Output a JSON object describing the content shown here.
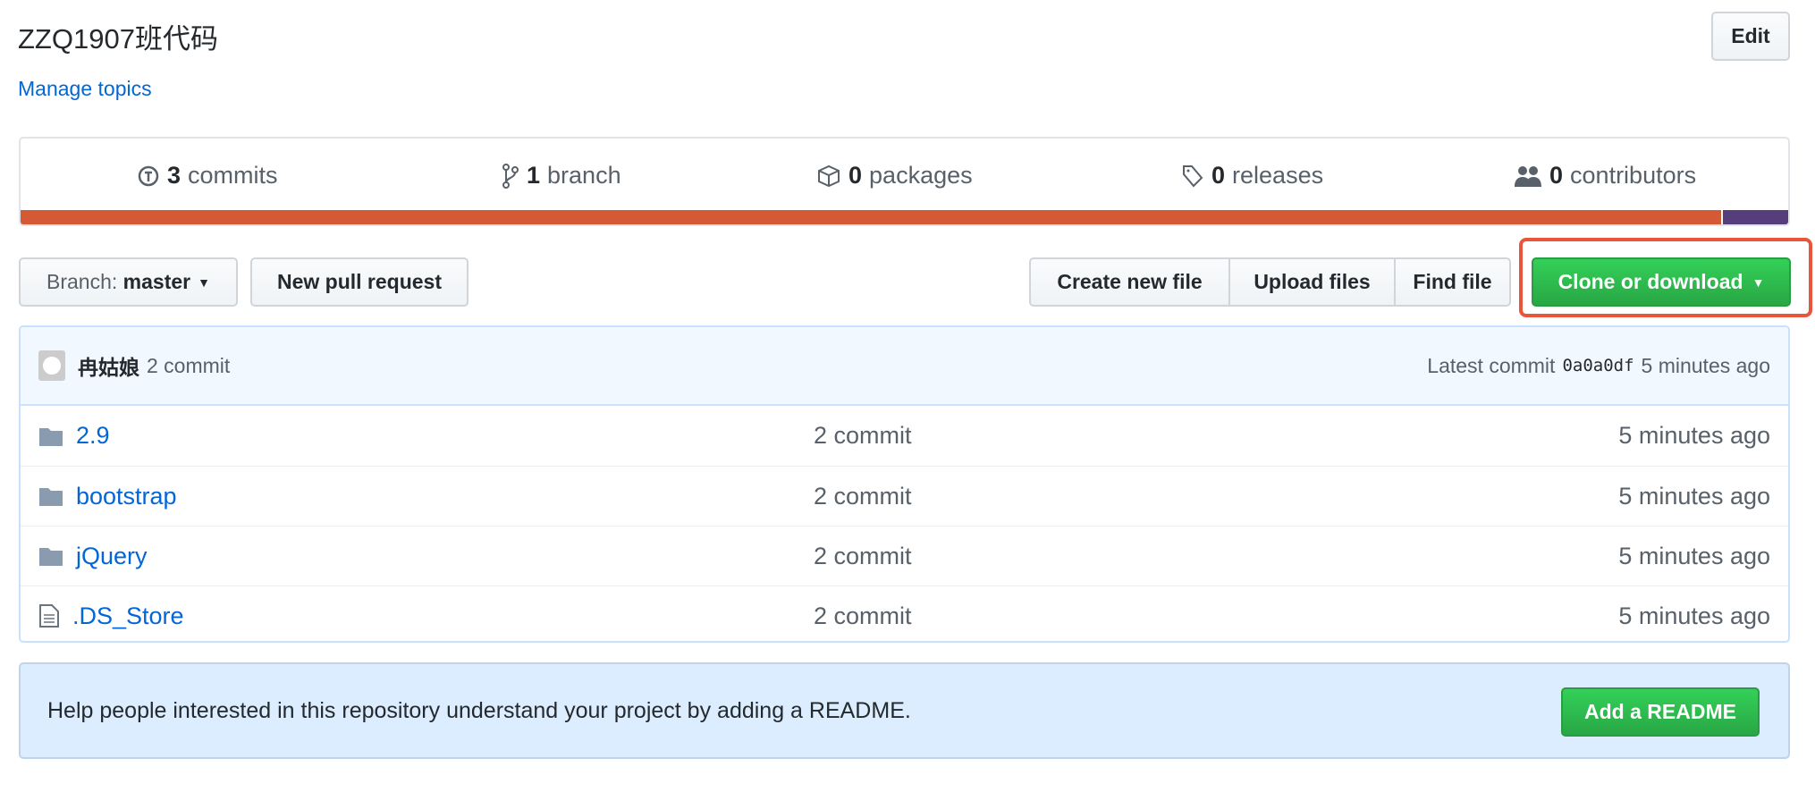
{
  "repo": {
    "title": "ZZQ1907班代码",
    "manage_topics": "Manage topics",
    "edit": "Edit"
  },
  "stats": [
    {
      "icon": "history-icon",
      "count": "3",
      "label": "commits"
    },
    {
      "icon": "branch-icon",
      "count": "1",
      "label": "branch"
    },
    {
      "icon": "package-icon",
      "count": "0",
      "label": "packages"
    },
    {
      "icon": "tag-icon",
      "count": "0",
      "label": "releases"
    },
    {
      "icon": "people-icon",
      "count": "0",
      "label": "contributors"
    }
  ],
  "languages": [
    {
      "color": "#d45a35",
      "percent": 96.2
    },
    {
      "color": "#563d7c",
      "percent": 3.8
    }
  ],
  "toolbar": {
    "branch_prefix": "Branch:",
    "branch": "master",
    "new_pr": "New pull request",
    "create_file": "Create new file",
    "upload": "Upload files",
    "find": "Find file",
    "clone": "Clone or download",
    "highlight_color": "#e8553a"
  },
  "latest": {
    "author": "冉姑娘",
    "message": "2 commit",
    "prefix": "Latest commit",
    "sha": "0a0a0df",
    "age": "5 minutes ago"
  },
  "files": [
    {
      "type": "folder",
      "name": "2.9",
      "message": "2 commit",
      "age": "5 minutes ago"
    },
    {
      "type": "folder",
      "name": "bootstrap",
      "message": "2 commit",
      "age": "5 minutes ago"
    },
    {
      "type": "folder",
      "name": "jQuery",
      "message": "2 commit",
      "age": "5 minutes ago"
    },
    {
      "type": "file",
      "name": ".DS_Store",
      "message": "2 commit",
      "age": "5 minutes ago"
    }
  ],
  "readme": {
    "text": "Help people interested in this repository understand your project by adding a README.",
    "button": "Add a README"
  }
}
